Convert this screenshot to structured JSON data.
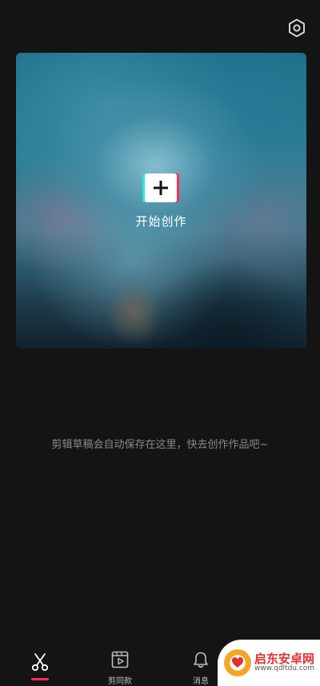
{
  "hero": {
    "create_label": "开始创作"
  },
  "empty_state": {
    "hint": "剪辑草稿会自动保存在这里，快去创作作品吧~"
  },
  "tabbar": {
    "tabs": [
      {
        "label": "",
        "icon": "scissors-icon",
        "active": true
      },
      {
        "label": "剪同款",
        "icon": "video-template-icon",
        "active": false
      },
      {
        "label": "消息",
        "icon": "bell-icon",
        "active": false
      }
    ]
  },
  "watermark": {
    "title": "启东安卓网",
    "url": "www.qdltdu.com"
  },
  "colors": {
    "background": "#141414",
    "accent_red": "#ff2d55",
    "accent_cyan": "#2ee6e6"
  }
}
